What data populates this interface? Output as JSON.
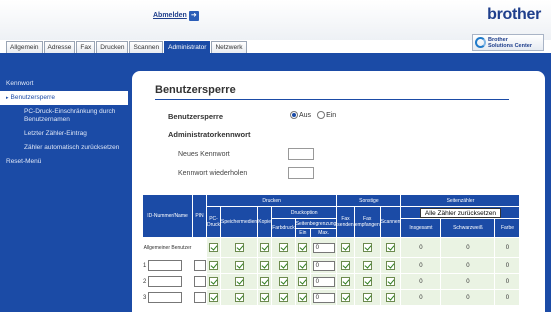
{
  "header": {
    "logout_label": "Abmelden",
    "logout_arrow": "➜",
    "brand": "brother",
    "solutions_line1": "Brother",
    "solutions_line2": "Solutions Center"
  },
  "tabs": [
    "Allgemein",
    "Adresse",
    "Fax",
    "Drucken",
    "Scannen",
    "Administrator",
    "Netzwerk"
  ],
  "active_tab": "Administrator",
  "sidebar": {
    "items": [
      {
        "label": "Kennwort"
      },
      {
        "label": "Benutzersperre"
      },
      {
        "label": "PC-Druck-Einschränkung durch Benutzernamen"
      },
      {
        "label": "Letzter Zähler-Eintrag"
      },
      {
        "label": "Zähler automatisch zurücksetzen"
      },
      {
        "label": "Reset-Menü"
      }
    ],
    "marker": "▸"
  },
  "page": {
    "title": "Benutzersperre",
    "lock_label": "Benutzersperre",
    "option_off": "Aus",
    "option_on": "Ein",
    "selected": "Aus",
    "admin_pw_label": "Administratorkennwort",
    "new_pw_label": "Neues Kennwort",
    "repeat_pw_label": "Kennwort wiederholen"
  },
  "table": {
    "header_id": "ID-Nummer/Name",
    "header_pin": "PIN",
    "group_print": "Drucken",
    "group_other": "Sonstige",
    "group_counter": "Seitenzähler",
    "col_pc_print": "PC-Druck",
    "col_storage": "Speichermedien",
    "col_copy": "Kopie",
    "group_print_option": "Druckoption",
    "col_color_print": "Farbdruck",
    "col_page_limit": "Seitenbegrenzung",
    "col_on": "Ein",
    "col_max": "Max.",
    "col_fax_send": "Fax senden",
    "col_fax_receive": "Fax empfangen",
    "col_scan": "Scannen",
    "reset_all_button": "Alle Zähler zurücksetzen",
    "col_total": "Insgesamt",
    "col_black": "Schwarzweiß",
    "col_color": "Farbe",
    "general_user": "Allgemeiner Benutzer",
    "general_max": "0",
    "general_counts": [
      "0",
      "0",
      "0"
    ],
    "rows": [
      {
        "num": "1",
        "max": "0",
        "counts": [
          "0",
          "0",
          "0"
        ]
      },
      {
        "num": "2",
        "max": "0",
        "counts": [
          "0",
          "0",
          "0"
        ]
      },
      {
        "num": "3",
        "max": "0",
        "counts": [
          "0",
          "0",
          "0"
        ]
      }
    ]
  },
  "colors": {
    "brand_blue": "#1b4ba6",
    "row_green": "#eaf3e3"
  }
}
